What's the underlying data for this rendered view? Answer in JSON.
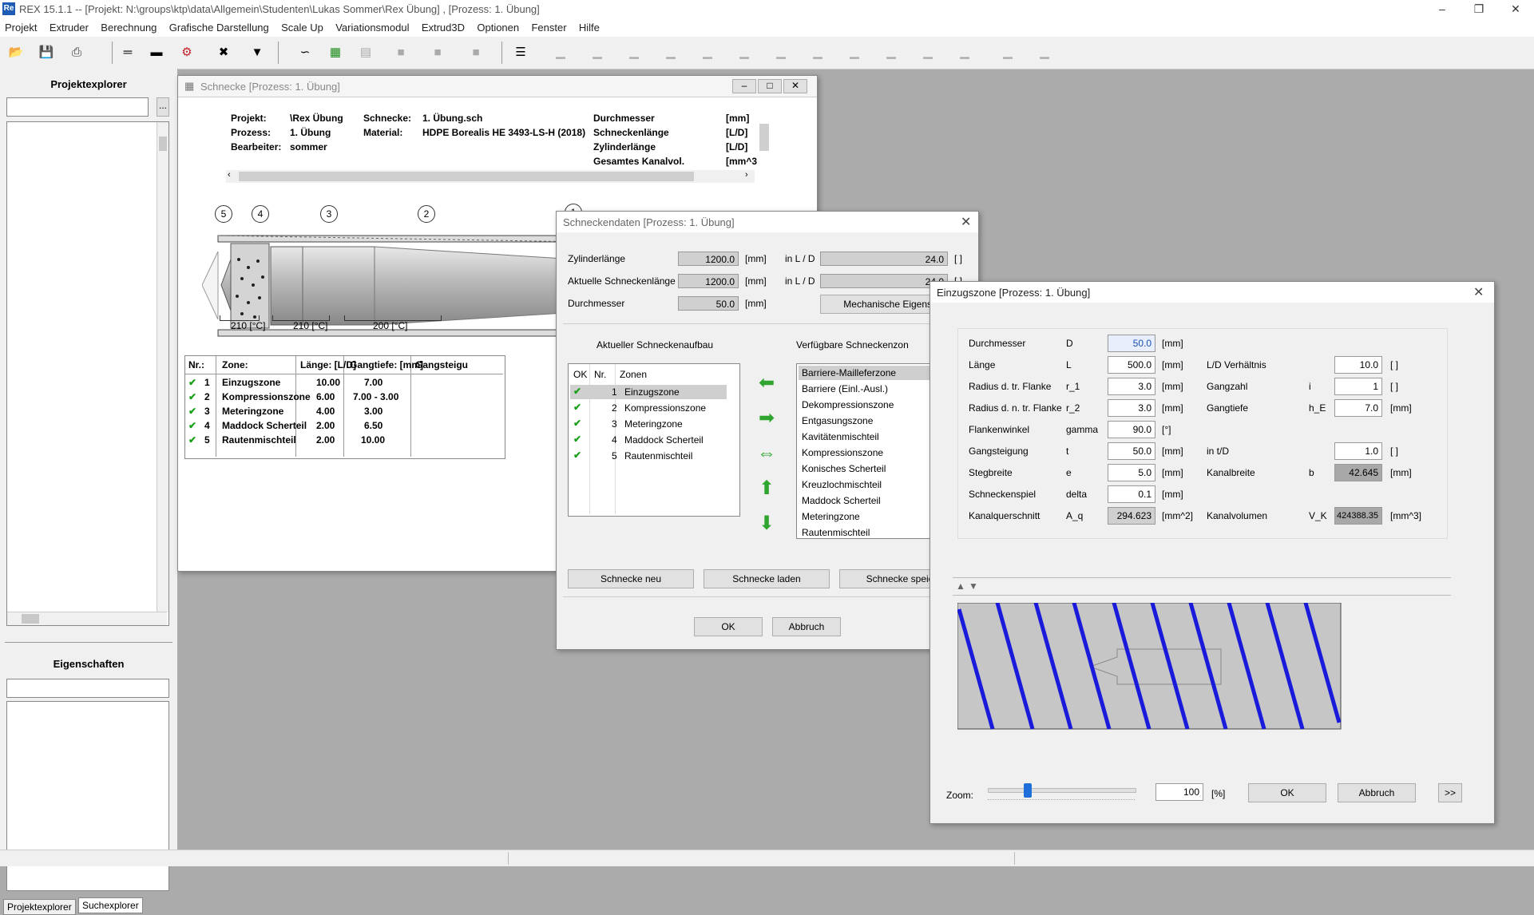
{
  "app": {
    "title": "REX 15.1.1 -- [Projekt: N:\\groups\\ktp\\data\\Allgemein\\Studenten\\Lukas Sommer\\Rex Übung] , [Prozess: 1. Übung]",
    "icon": "Re"
  },
  "menu": [
    "Projekt",
    "Extruder",
    "Berechnung",
    "Grafische Darstellung",
    "Scale Up",
    "Variationsmodul",
    "Extrud3D",
    "Optionen",
    "Fenster",
    "Hilfe"
  ],
  "left": {
    "explorer_title": "Projektexplorer",
    "browse": "...",
    "properties_title": "Eigenschaften",
    "tabs": [
      "Projektexplorer",
      "Suchexplorer"
    ]
  },
  "schnecke_window": {
    "title": "Schnecke [Prozess: 1. Übung]",
    "info": [
      {
        "label": "Projekt:",
        "value": "\\Rex Übung"
      },
      {
        "label": "Prozess:",
        "value": "1. Übung"
      },
      {
        "label": "Bearbeiter:",
        "value": "sommer"
      }
    ],
    "info2": [
      {
        "label": "Schnecke:",
        "value": "1. Übung.sch"
      },
      {
        "label": "Material:",
        "value": "HDPE Borealis HE 3493-LS-H (2018)"
      }
    ],
    "info3": [
      {
        "label": "Durchmesser",
        "unit": "[mm]"
      },
      {
        "label": "Schneckenlänge",
        "unit": "[L/D]"
      },
      {
        "label": "Zylinderlänge",
        "unit": "[L/D]"
      },
      {
        "label": "Gesamtes Kanalvol.",
        "unit": "[mm^3"
      }
    ],
    "zone_markers": [
      "5",
      "4",
      "3",
      "2",
      "1"
    ],
    "temps": [
      "210 [°C]",
      "210 [°C]",
      "200 [°C]"
    ],
    "table": {
      "headers": [
        "Nr.:",
        "Zone:",
        "Länge: [L/D]",
        "Gangtiefe: [mm]",
        "Gangsteigu"
      ],
      "rows": [
        {
          "nr": "1",
          "zone": "Einzugszone",
          "len": "10.00",
          "depth": "7.00"
        },
        {
          "nr": "2",
          "zone": "Kompressionszone",
          "len": "6.00",
          "depth": "7.00 - 3.00"
        },
        {
          "nr": "3",
          "zone": "Meteringzone",
          "len": "4.00",
          "depth": "3.00"
        },
        {
          "nr": "4",
          "zone": "Maddock Scherteil",
          "len": "2.00",
          "depth": "6.50"
        },
        {
          "nr": "5",
          "zone": "Rautenmischteil",
          "len": "2.00",
          "depth": "10.00"
        }
      ]
    }
  },
  "schneckendaten": {
    "title": "Schneckendaten  [Prozess: 1. Übung]",
    "rows": [
      {
        "label": "Zylinderlänge",
        "value": "1200.0",
        "unit": "[mm]",
        "ld_label": "in L / D",
        "ld": "24.0",
        "ld_unit": "[ ]"
      },
      {
        "label": "Aktuelle Schneckenlänge",
        "value": "1200.0",
        "unit": "[mm]",
        "ld_label": "in L / D",
        "ld": "24.0",
        "ld_unit": "[ ]"
      },
      {
        "label": "Durchmesser",
        "value": "50.0",
        "unit": "[mm]"
      }
    ],
    "mech_button": "Mechanische Eigenschaf",
    "current_title": "Aktueller Schneckenaufbau",
    "available_title": "Verfügbare Schneckenzon",
    "list_headers": [
      "OK",
      "Nr.",
      "Zonen"
    ],
    "current_zones": [
      {
        "nr": "1",
        "name": "Einzugszone"
      },
      {
        "nr": "2",
        "name": "Kompressionszone"
      },
      {
        "nr": "3",
        "name": "Meteringzone"
      },
      {
        "nr": "4",
        "name": "Maddock Scherteil"
      },
      {
        "nr": "5",
        "name": "Rautenmischteil"
      }
    ],
    "available_zones": [
      "Barriere-Mailleferzone",
      "Barriere (Einl.-Ausl.)",
      "Dekompressionszone",
      "Entgasungszone",
      "Kavitätenmischteil",
      "Kompressionszone",
      "Konisches Scherteil",
      "Kreuzlochmischteil",
      "Maddock Scherteil",
      "Meteringzone",
      "Rautenmischteil"
    ],
    "buttons": [
      "Schnecke neu",
      "Schnecke laden",
      "Schnecke speich"
    ],
    "ok": "OK",
    "cancel": "Abbruch"
  },
  "einzugszone": {
    "title": "Einzugszone  [Prozess: 1. Übung]",
    "left_rows": [
      {
        "label": "Durchmesser",
        "sym": "D",
        "value": "50.0",
        "unit": "[mm]"
      },
      {
        "label": "Länge",
        "sym": "L",
        "value": "500.0",
        "unit": "[mm]"
      },
      {
        "label": "Radius d. tr. Flanke",
        "sym": "r_1",
        "value": "3.0",
        "unit": "[mm]"
      },
      {
        "label": "Radius d. n. tr. Flanke",
        "sym": "r_2",
        "value": "3.0",
        "unit": "[mm]"
      },
      {
        "label": "Flankenwinkel",
        "sym": "gamma",
        "value": "90.0",
        "unit": "[°]"
      },
      {
        "label": "Gangsteigung",
        "sym": "t",
        "value": "50.0",
        "unit": "[mm]"
      },
      {
        "label": "Stegbreite",
        "sym": "e",
        "value": "5.0",
        "unit": "[mm]"
      },
      {
        "label": "Schneckenspiel",
        "sym": "delta",
        "value": "0.1",
        "unit": "[mm]"
      },
      {
        "label": "Kanalquerschnitt",
        "sym": "A_q",
        "value": "294.623",
        "unit": "[mm^2]"
      }
    ],
    "right_rows": [
      {
        "label": "L/D Verhältnis",
        "sym": "",
        "value": "10.0",
        "unit": "[ ]"
      },
      {
        "label": "Gangzahl",
        "sym": "i",
        "value": "1",
        "unit": "[ ]"
      },
      {
        "label": "Gangtiefe",
        "sym": "h_E",
        "value": "7.0",
        "unit": "[mm]"
      },
      {
        "label": "in t/D",
        "sym": "",
        "value": "1.0",
        "unit": "[ ]"
      },
      {
        "label": "Kanalbreite",
        "sym": "b",
        "value": "42.645",
        "unit": "[mm]"
      },
      {
        "label": "Kanalvolumen",
        "sym": "V_K",
        "value": "424388.35",
        "unit": "[mm^3]"
      }
    ],
    "zoom_label": "Zoom:",
    "zoom_value": "100",
    "zoom_unit": "[%]",
    "zoom_level": 0.25,
    "ok": "OK",
    "cancel": "Abbruch",
    "more": ">>"
  }
}
